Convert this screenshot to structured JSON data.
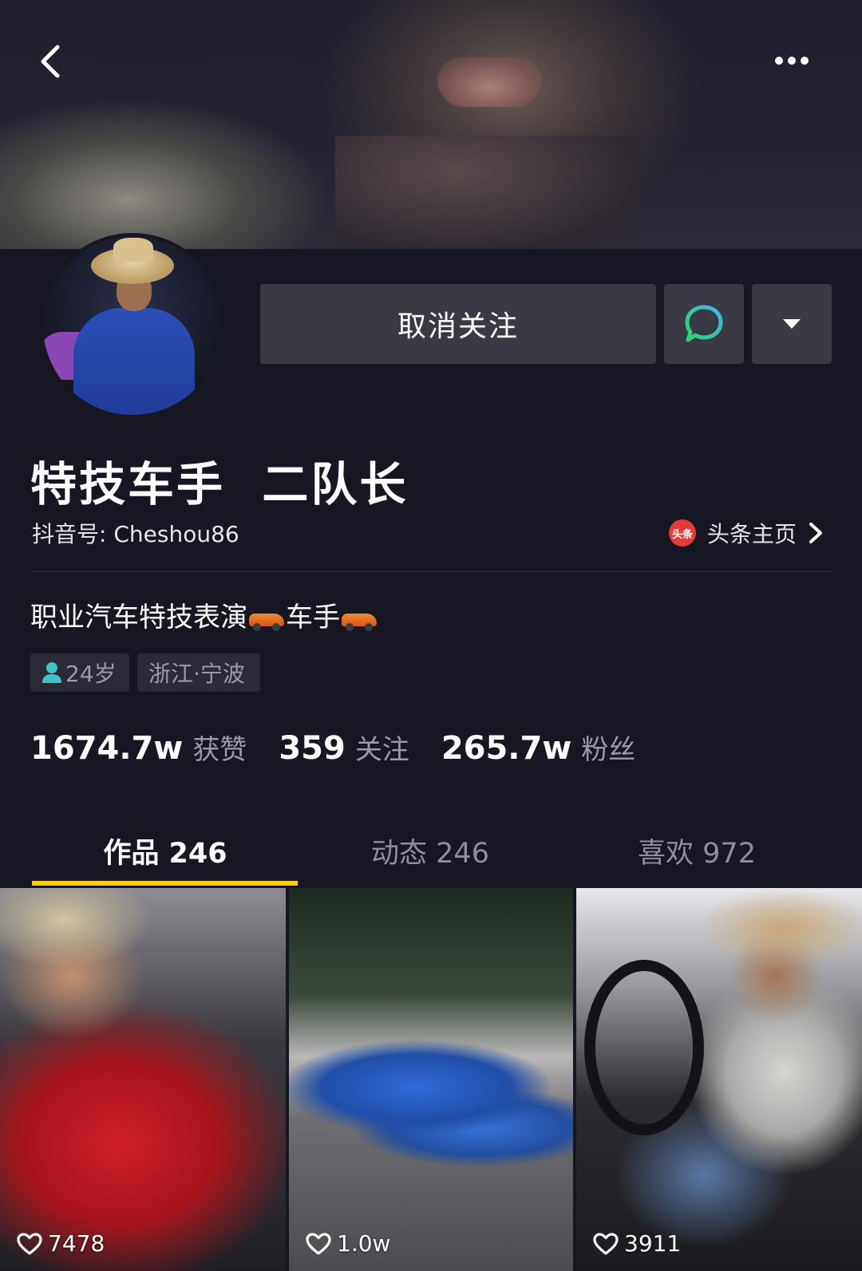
{
  "profile": {
    "nickname": "特技车手  二队长",
    "douyin_id": "抖音号: Cheshou86",
    "toutiao_link": "头条主页",
    "toutiao_logo": "头条",
    "bio_part1": "职业汽车特技表演",
    "bio_part2": "车手",
    "bio_emoji": "racing-car-emoji",
    "age_tag": "24岁",
    "location_tag": "浙江·宁波"
  },
  "actions": {
    "unfollow_label": "取消关注",
    "message_icon": "chat-bubble-icon",
    "more_icon": "caret-down-icon"
  },
  "header": {
    "back_icon": "chevron-left-icon",
    "menu_icon": "more-dots-icon"
  },
  "stats": [
    {
      "value": "1674.7w",
      "label": "获赞"
    },
    {
      "value": "359",
      "label": "关注"
    },
    {
      "value": "265.7w",
      "label": "粉丝"
    }
  ],
  "tabs": [
    {
      "label": "作品 246",
      "active": true
    },
    {
      "label": "动态 246",
      "active": false
    },
    {
      "label": "喜欢 972",
      "active": false
    }
  ],
  "videos": [
    {
      "likes": "7478"
    },
    {
      "likes": "1.0w"
    },
    {
      "likes": "3911"
    }
  ],
  "colors": {
    "background": "#161722",
    "button": "#393a44",
    "tab_indicator": "#face15",
    "message_icon_gradient": [
      "#2fd26b",
      "#3fb9e8"
    ],
    "muted_text": "#9a9ba6"
  }
}
